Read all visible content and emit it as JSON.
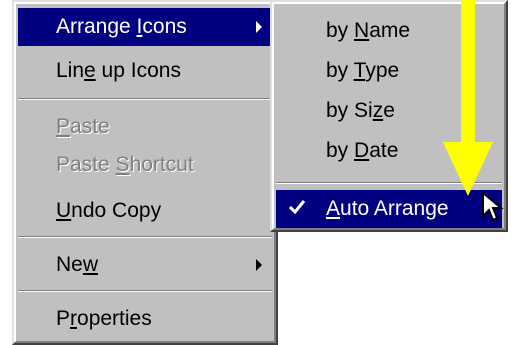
{
  "main_menu": {
    "items": [
      {
        "pre": "Arrange ",
        "key": "I",
        "post": "cons",
        "state": "highlighted",
        "submenu": true
      },
      {
        "pre": "Lin",
        "key": "e",
        "post": " up Icons",
        "state": "normal"
      },
      {
        "pre": "",
        "key": "P",
        "post": "aste",
        "state": "disabled"
      },
      {
        "pre": "Paste ",
        "key": "S",
        "post": "hortcut",
        "state": "disabled"
      },
      {
        "pre": "",
        "key": "U",
        "post": "ndo Copy",
        "state": "normal"
      },
      {
        "pre": "Ne",
        "key": "w",
        "post": "",
        "state": "normal",
        "submenu": true
      },
      {
        "pre": "P",
        "key": "r",
        "post": "operties",
        "state": "normal"
      }
    ]
  },
  "sub_menu": {
    "items": [
      {
        "pre": "by ",
        "key": "N",
        "post": "ame",
        "state": "normal"
      },
      {
        "pre": "by ",
        "key": "T",
        "post": "ype",
        "state": "normal"
      },
      {
        "pre": "by Si",
        "key": "z",
        "post": "e",
        "state": "normal"
      },
      {
        "pre": "by ",
        "key": "D",
        "post": "ate",
        "state": "normal"
      },
      {
        "pre": "",
        "key": "A",
        "post": "uto Arrange",
        "state": "highlighted",
        "checked": true
      }
    ]
  },
  "colors": {
    "menu_bg": "#c0c0c0",
    "highlight": "#000080",
    "annotation_arrow": "#ffff00",
    "disabled_text": "#808080"
  },
  "icons": {
    "submenu_arrow": "triangle-right",
    "check": "checkmark",
    "annotation": "yellow-down-arrow",
    "cursor": "mouse-pointer"
  }
}
